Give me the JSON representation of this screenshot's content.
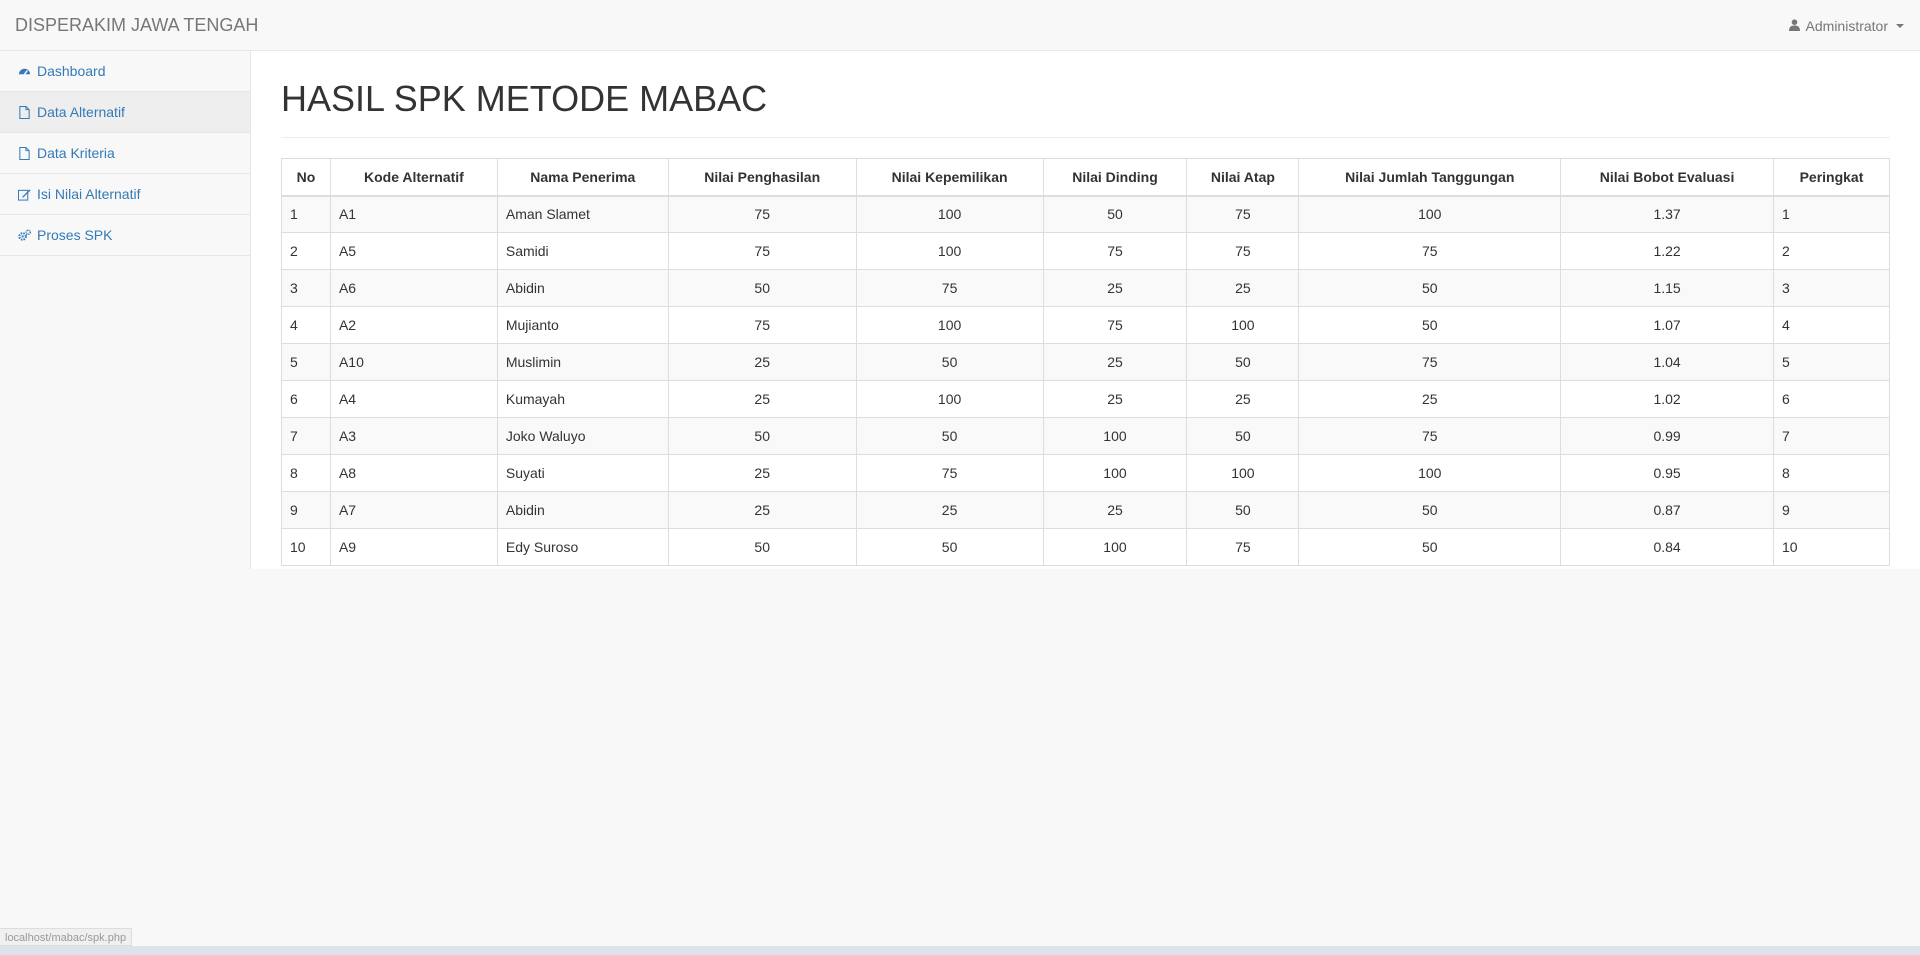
{
  "navbar": {
    "brand": "DISPERAKIM JAWA TENGAH",
    "user": "Administrator"
  },
  "sidebar": {
    "items": [
      {
        "label": "Dashboard",
        "icon": "dashboard-icon"
      },
      {
        "label": "Data Alternatif",
        "icon": "file-icon"
      },
      {
        "label": "Data Kriteria",
        "icon": "file-icon"
      },
      {
        "label": "Isi Nilai Alternatif",
        "icon": "edit-icon"
      },
      {
        "label": "Proses SPK",
        "icon": "gears-icon"
      }
    ]
  },
  "main": {
    "title": "HASIL SPK METODE MABAC",
    "table": {
      "headers": [
        "No",
        "Kode Alternatif",
        "Nama Penerima",
        "Nilai Penghasilan",
        "Nilai Kepemilikan",
        "Nilai Dinding",
        "Nilai Atap",
        "Nilai Jumlah Tanggungan",
        "Nilai Bobot Evaluasi",
        "Peringkat"
      ],
      "rows": [
        [
          "1",
          "A1",
          "Aman Slamet",
          "75",
          "100",
          "50",
          "75",
          "100",
          "1.37",
          "1"
        ],
        [
          "2",
          "A5",
          "Samidi",
          "75",
          "100",
          "75",
          "75",
          "75",
          "1.22",
          "2"
        ],
        [
          "3",
          "A6",
          "Abidin",
          "50",
          "75",
          "25",
          "25",
          "50",
          "1.15",
          "3"
        ],
        [
          "4",
          "A2",
          "Mujianto",
          "75",
          "100",
          "75",
          "100",
          "50",
          "1.07",
          "4"
        ],
        [
          "5",
          "A10",
          "Muslimin",
          "25",
          "50",
          "25",
          "50",
          "75",
          "1.04",
          "5"
        ],
        [
          "6",
          "A4",
          "Kumayah",
          "25",
          "100",
          "25",
          "25",
          "25",
          "1.02",
          "6"
        ],
        [
          "7",
          "A3",
          "Joko Waluyo",
          "50",
          "50",
          "100",
          "50",
          "75",
          "0.99",
          "7"
        ],
        [
          "8",
          "A8",
          "Suyati",
          "25",
          "75",
          "100",
          "100",
          "100",
          "0.95",
          "8"
        ],
        [
          "9",
          "A7",
          "Abidin",
          "25",
          "25",
          "25",
          "50",
          "50",
          "0.87",
          "9"
        ],
        [
          "10",
          "A9",
          "Edy Suroso",
          "50",
          "50",
          "100",
          "75",
          "50",
          "0.84",
          "10"
        ]
      ]
    }
  },
  "statusbar": {
    "url": "localhost/mabac/spk.php"
  },
  "colors": {
    "link": "#337ab7",
    "navbar_text": "#777777",
    "stripe": "#f9f9f9",
    "border": "#dddddd"
  }
}
